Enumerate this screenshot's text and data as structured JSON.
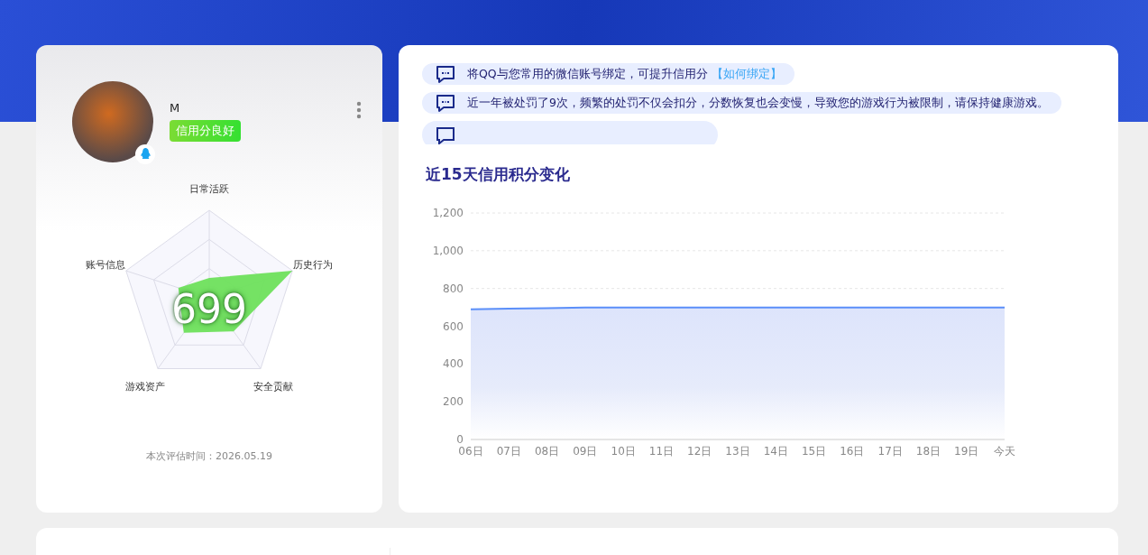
{
  "profile": {
    "name": "M",
    "badge": "信用分良好",
    "score": "699",
    "radar_labels": [
      "日常活跃",
      "历史行为",
      "安全贡献",
      "游戏资产",
      "账号信息"
    ],
    "eval_time": "本次评估时间：2026.05.19"
  },
  "notices": [
    {
      "text": "将QQ与您常用的微信账号绑定，可提升信用分",
      "link": "【如何绑定】"
    },
    {
      "text": "近一年被处罚了9次，频繁的处罚不仅会扣分，分数恢复也会变慢，导致您的游戏行为被限制，请保持健康游戏。"
    }
  ],
  "chart": {
    "title": "近15天信用积分变化",
    "chart_data": {
      "type": "area",
      "categories": [
        "06日",
        "07日",
        "08日",
        "09日",
        "10日",
        "11日",
        "12日",
        "13日",
        "14日",
        "15日",
        "16日",
        "17日",
        "18日",
        "19日",
        "今天"
      ],
      "series": [
        {
          "color": "#5b8ff9",
          "values": [
            690,
            693,
            696,
            699,
            699,
            699,
            699,
            699,
            699,
            699,
            699,
            699,
            699,
            699,
            699
          ]
        }
      ],
      "ylim": [
        0,
        1200
      ],
      "yticks": [
        0,
        200,
        400,
        600,
        800,
        {
          "value": 1000,
          "label": "1,000"
        },
        {
          "value": 1200,
          "label": "1,200"
        }
      ]
    }
  }
}
